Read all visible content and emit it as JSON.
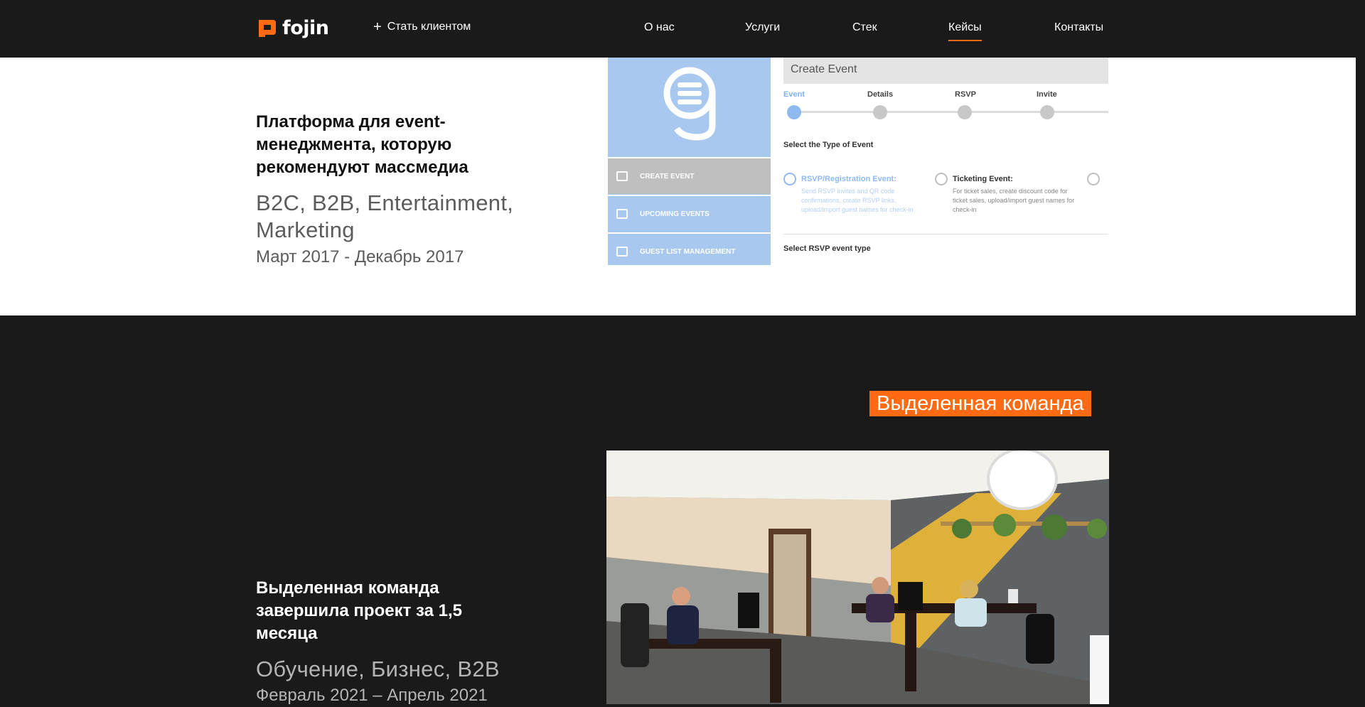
{
  "header": {
    "logo_text": "fojin",
    "cta_label": "Стать клиентом",
    "nav": [
      {
        "label": "О нас"
      },
      {
        "label": "Услуги"
      },
      {
        "label": "Стек"
      },
      {
        "label": "Кейсы",
        "active": true
      },
      {
        "label": "Контакты"
      }
    ]
  },
  "colors": {
    "accent": "#ff6a13",
    "dark_bg": "#1a1a1a",
    "light_bg": "#ffffff"
  },
  "case1": {
    "title": "Платформа для event-менеджмента, которую рекомендуют массмедиа",
    "title_lines": [
      "Платформа для event-",
      "менеджмента, которую",
      "рекомендуют массмедиа"
    ],
    "tags_lines": [
      "B2C, B2B, Entertainment,",
      "Marketing"
    ],
    "date": "Март 2017 - Декабрь 2017",
    "screenshot": {
      "header_title": "Create Event",
      "steps": [
        "Event",
        "Details",
        "RSVP",
        "Invite"
      ],
      "menu": [
        "CREATE EVENT",
        "UPCOMING EVENTS",
        "GUEST LIST MANAGEMENT"
      ],
      "type_heading": "Select the Type of Event",
      "option1_title": "RSVP/Registration Event:",
      "option1_desc": [
        "Send RSVP invites and QR code",
        "confirmations, create RSVP links,",
        "upload/import guest names for check-in"
      ],
      "option2_title": "Ticketing Event:",
      "option2_desc": [
        "For ticket sales, create discount code for",
        "ticket sales, upload/import guest names for",
        "check-in"
      ],
      "rsvp_heading": "Select RSVP event type"
    }
  },
  "case2": {
    "badge": "Выделенная команда",
    "title_lines": [
      "Выделенная команда",
      "завершила проект за 1,5",
      "месяца"
    ],
    "tags": "Обучение, Бизнес, B2B",
    "date": "Февраль 2021 – Апрель 2021"
  }
}
